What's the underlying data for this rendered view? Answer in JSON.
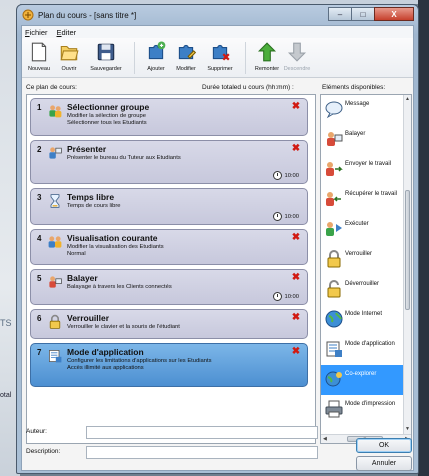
{
  "window": {
    "title": "Plan du cours - [sans titre *]",
    "controls": {
      "minimize": "–",
      "maximize": "□",
      "close": "X"
    }
  },
  "menu": [
    {
      "label": "Fichier",
      "accel": "F"
    },
    {
      "label": "Editer",
      "accel": "E"
    }
  ],
  "toolbar": [
    {
      "id": "nouveau",
      "label": "Nouveau",
      "icon": "new-document-icon",
      "enabled": true
    },
    {
      "id": "ouvrir",
      "label": "Ouvrir",
      "icon": "open-folder-icon",
      "enabled": true
    },
    {
      "id": "sauvegarder",
      "label": "Sauvegarder",
      "icon": "save-floppy-icon",
      "enabled": true
    },
    {
      "id": "ajouter",
      "label": "Ajouter",
      "icon": "add-puzzle-icon",
      "enabled": true
    },
    {
      "id": "modifier",
      "label": "Modifier",
      "icon": "edit-puzzle-icon",
      "enabled": true
    },
    {
      "id": "supprimer",
      "label": "Supprimer",
      "icon": "delete-puzzle-icon",
      "enabled": true
    },
    {
      "id": "remonter",
      "label": "Remonter",
      "icon": "arrow-up-icon",
      "enabled": true
    },
    {
      "id": "descendre",
      "label": "Descendre",
      "icon": "arrow-down-icon",
      "enabled": false
    }
  ],
  "panels": {
    "plan_header": "Ce plan de cours:",
    "duration_header": "Durée totaled u cours (hh:mm) :",
    "elements_header": "Eléments disponibles:"
  },
  "steps": [
    {
      "num": "1",
      "title": "Sélectionner groupe",
      "desc": [
        "Modifier la sélection de groupe",
        "Sélectionner tous les Etudiants"
      ],
      "icon": "group-select-icon",
      "duration": "",
      "deletable": true,
      "selected": false
    },
    {
      "num": "2",
      "title": "Présenter",
      "desc": [
        "Présenter le bureau du Tuteur aux Etudiants"
      ],
      "icon": "presenter-icon",
      "duration": "10:00",
      "deletable": true,
      "selected": false
    },
    {
      "num": "3",
      "title": "Temps libre",
      "desc": [
        "Temps de cours libre"
      ],
      "icon": "hourglass-icon",
      "duration": "10:00",
      "deletable": false,
      "selected": false
    },
    {
      "num": "4",
      "title": "Visualisation courante",
      "desc": [
        "Modifier la visualisation des Etudiants",
        "Normal"
      ],
      "icon": "view-group-icon",
      "duration": "",
      "deletable": true,
      "selected": false
    },
    {
      "num": "5",
      "title": "Balayer",
      "desc": [
        "Balayage à travers les Clients connectés"
      ],
      "icon": "scan-icon",
      "duration": "10:00",
      "deletable": true,
      "selected": false
    },
    {
      "num": "6",
      "title": "Verrouiller",
      "desc": [
        "Verrouiller le clavier et la souris de l'étudiant"
      ],
      "icon": "padlock-icon",
      "duration": "",
      "deletable": true,
      "selected": false
    },
    {
      "num": "7",
      "title": "Mode d'application",
      "desc": [
        "Configurer les limitations d'applications sur les Etudiants",
        "Accès illimité aux applications"
      ],
      "icon": "application-mode-icon",
      "duration": "",
      "deletable": true,
      "selected": true
    }
  ],
  "elements": [
    {
      "label": "Message",
      "icon": "message-bubble-icon",
      "selected": false
    },
    {
      "label": "Balayer",
      "icon": "scan-icon",
      "selected": false
    },
    {
      "label": "Envoyer le travail",
      "icon": "send-work-icon",
      "selected": false
    },
    {
      "label": "Récupérer le travail",
      "icon": "collect-work-icon",
      "selected": false
    },
    {
      "label": "Exécuter",
      "icon": "execute-icon",
      "selected": false
    },
    {
      "label": "Verrouiller",
      "icon": "padlock-icon",
      "selected": false
    },
    {
      "label": "Déverrouiller",
      "icon": "unlock-icon",
      "selected": false
    },
    {
      "label": "Mode Internet",
      "icon": "globe-icon",
      "selected": false
    },
    {
      "label": "Mode d'application",
      "icon": "application-mode-icon",
      "selected": false
    },
    {
      "label": "Co-explorer",
      "icon": "co-explore-globe-icon",
      "selected": true
    },
    {
      "label": "Mode d'impression",
      "icon": "printer-icon",
      "selected": false
    }
  ],
  "form": {
    "author_label": "Auteur:",
    "author_accel": "A",
    "author_value": "",
    "description_label": "Description:",
    "description_accel": "D",
    "description_value": ""
  },
  "buttons": {
    "ok": "OK",
    "cancel": "Annuler"
  },
  "background": {
    "fragment1": "TS",
    "fragment2": "otal"
  },
  "colors": {
    "selected_step": "#4c8fd1",
    "selected_element": "#3399ff",
    "delete": "#d11a12"
  }
}
